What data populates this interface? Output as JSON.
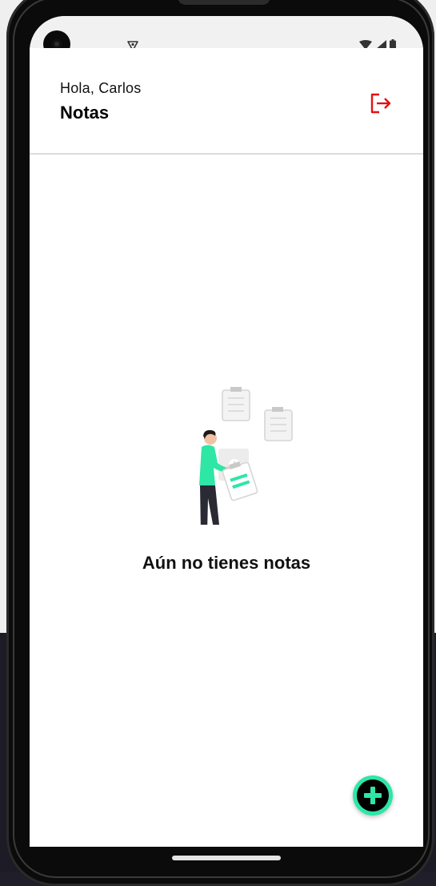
{
  "app": {
    "greeting": "Hola, Carlos",
    "title": "Notas",
    "empty_message": "Aún no tienes notas"
  },
  "icons": {
    "logout": "logout-icon",
    "add": "plus-icon",
    "camera": "camera-icon",
    "shield": "shield-icon",
    "wifi": "wifi-icon",
    "signal": "signal-icon",
    "battery": "battery-icon"
  },
  "colors": {
    "accent": "#2ee6a6",
    "logout": "#e61010",
    "text": "#111111",
    "divider": "#dcdcdc"
  }
}
